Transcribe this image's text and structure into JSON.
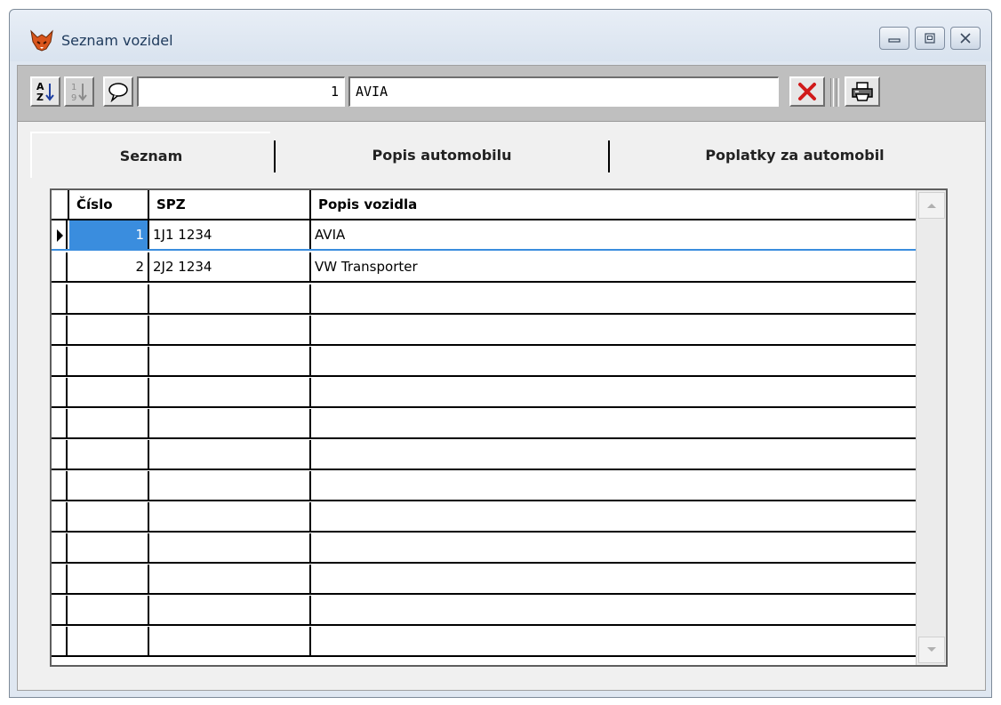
{
  "window": {
    "title": "Seznam vozidel",
    "icon": "fox-icon"
  },
  "toolbar": {
    "sort_az_icon": "sort-az-icon",
    "sort_19_icon": "sort-numeric-icon",
    "note_icon": "speech-bubble-icon",
    "record_number": "1",
    "search_value": "AVIA",
    "delete_icon": "close-icon",
    "print_icon": "printer-icon"
  },
  "tabs": [
    {
      "label": "Seznam",
      "active": true
    },
    {
      "label": "Popis automobilu",
      "active": false
    },
    {
      "label": "Poplatky za automobil",
      "active": false
    }
  ],
  "grid": {
    "columns": [
      "Číslo",
      "SPZ",
      "Popis vozidla"
    ],
    "rows": [
      {
        "cislo": "1",
        "spz": "1J1 1234",
        "popis": "AVIA"
      },
      {
        "cislo": "2",
        "spz": "2J2 1234",
        "popis": "VW Transporter"
      }
    ]
  },
  "colors": {
    "selection": "#3a8dde",
    "toolbar_bg": "#bfbfbf",
    "delete_red": "#d11a1a"
  }
}
